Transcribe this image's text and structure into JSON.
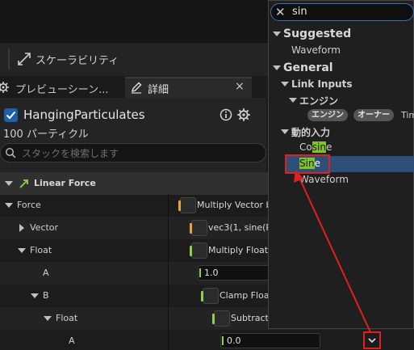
{
  "toolbar": {
    "scalability_label": "スケーラビリティ"
  },
  "tabs": {
    "preview_label": "プレビューシーン...",
    "details_label": "詳細",
    "close_glyph": "×"
  },
  "emitter": {
    "name": "HangingParticulates",
    "particle_count": "100 パーティクル",
    "search_placeholder": "スタックを検索します"
  },
  "tree": {
    "section": "Linear Force",
    "force_label": "Force",
    "force_value": "Multiply Vector b",
    "vector_label": "Vector",
    "vector_value": "vec3(1, sine(P",
    "float_label": "Float",
    "float_value": "Multiply Float",
    "a_label": "A",
    "a_value": "1.0",
    "b_label": "B",
    "b_value": "Clamp Float",
    "float2_label": "Float",
    "float2_value": "Subtract",
    "a2_label": "A",
    "a2_value": "0.0"
  },
  "popup": {
    "close_glyph": "✕",
    "query": "sin",
    "suggested": "Suggested",
    "waveform1": "Waveform",
    "general": "General",
    "link_inputs": "Link Inputs",
    "engine": "エンジン",
    "tag_engine": "エンジン",
    "tag_owner": "オーナー",
    "tag_tim": "Tim",
    "dynamic_inputs": "動的入力",
    "cosine_pre": "Co",
    "cosine_hl": "sin",
    "cosine_post": "e",
    "sine_hl": "Sin",
    "sine_post": "e",
    "waveform2": "Waveform"
  },
  "colors": {
    "highlight": "#7fc22a",
    "selection": "#2d4f78",
    "annotation": "#e02020",
    "accent_blue": "#1f5fa8"
  }
}
